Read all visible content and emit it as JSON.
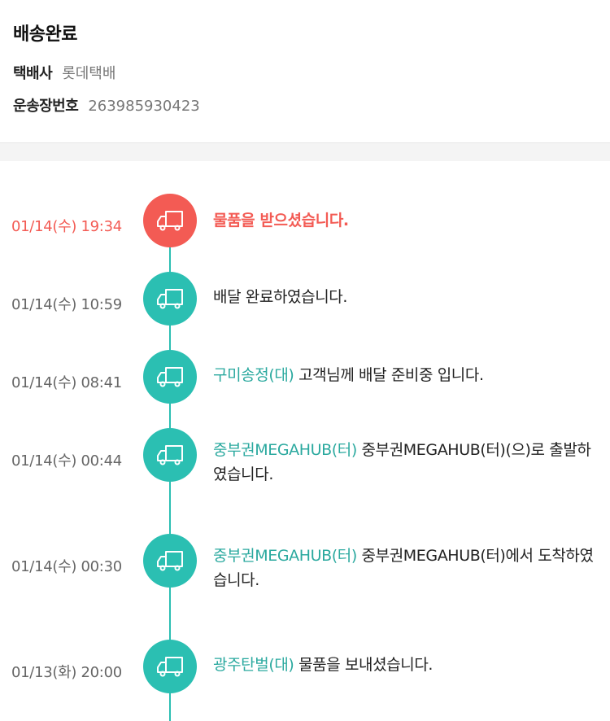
{
  "header": {
    "status": "배송완료",
    "carrier_label": "택배사",
    "carrier_value": "롯데택배",
    "tracking_label": "운송장번호",
    "tracking_value": "263985930423"
  },
  "events": [
    {
      "time": "01/14(수) 19:34",
      "location": "",
      "message": "물품을 받으셨습니다.",
      "icon": "truck-icon",
      "status": "current"
    },
    {
      "time": "01/14(수) 10:59",
      "location": "",
      "message": "배달 완료하였습니다.",
      "icon": "truck-icon"
    },
    {
      "time": "01/14(수) 08:41",
      "location": "구미송정(대)",
      "message": " 고객님께 배달 준비중 입니다.",
      "icon": "truck-icon"
    },
    {
      "time": "01/14(수) 00:44",
      "location": "중부권MEGAHUB(터)",
      "message": " 중부권MEGAHUB(터)(으)로 출발하였습니다.",
      "icon": "truck-icon"
    },
    {
      "time": "01/14(수) 00:30",
      "location": "중부권MEGAHUB(터)",
      "message": " 중부권MEGAHUB(터)에서 도착하였습니다.",
      "icon": "truck-icon"
    },
    {
      "time": "01/13(화) 20:00",
      "location": "광주탄벌(대)",
      "message": " 물품을 보내셨습니다.",
      "icon": "truck-icon"
    }
  ],
  "colors": {
    "active": "#f35b54",
    "teal": "#2bbfb2",
    "location_text": "#2ba99f"
  }
}
